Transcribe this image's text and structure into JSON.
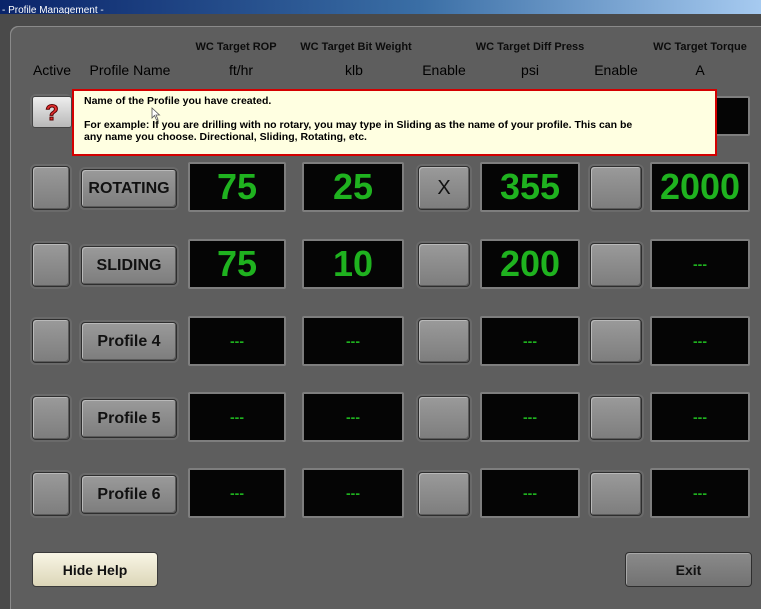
{
  "window": {
    "title": "- Profile Management -"
  },
  "headers": {
    "wc_rop": "WC Target ROP",
    "wc_bit_weight": "WC Target Bit Weight",
    "wc_diff_press": "WC Target Diff Press",
    "wc_torque": "WC Target Torque",
    "active": "Active",
    "profile_name": "Profile Name",
    "ft_hr": "ft/hr",
    "klb": "klb",
    "enable1": "Enable",
    "psi": "psi",
    "enable2": "Enable",
    "amps": "A"
  },
  "help_tooltip": {
    "line1": "Name of the Profile you have created.",
    "line2": "For example:  If you are drilling with no rotary, you may type in Sliding as the name of your profile.  This can be",
    "line3": "any name you choose.  Directional, Sliding, Rotating, etc."
  },
  "rows": [
    {
      "name": "ROTATING",
      "rop": "75",
      "bit_weight": "25",
      "enable_dp": "X",
      "diff_press": "355",
      "enable_tq": "",
      "torque": "2000"
    },
    {
      "name": "SLIDING",
      "rop": "75",
      "bit_weight": "10",
      "enable_dp": "",
      "diff_press": "200",
      "enable_tq": "",
      "torque": "---"
    },
    {
      "name": "Profile 4",
      "rop": "---",
      "bit_weight": "---",
      "enable_dp": "",
      "diff_press": "---",
      "enable_tq": "",
      "torque": "---"
    },
    {
      "name": "Profile 5",
      "rop": "---",
      "bit_weight": "---",
      "enable_dp": "",
      "diff_press": "---",
      "enable_tq": "",
      "torque": "---"
    },
    {
      "name": "Profile 6",
      "rop": "---",
      "bit_weight": "---",
      "enable_dp": "",
      "diff_press": "---",
      "enable_tq": "",
      "torque": "---"
    }
  ],
  "buttons": {
    "hide_help": "Hide Help",
    "exit": "Exit"
  },
  "icons": {
    "help": "question-mark-icon"
  },
  "colors": {
    "led_text": "#1fb21f",
    "tooltip_border": "#d40000",
    "tooltip_bg": "#ffffe1"
  }
}
